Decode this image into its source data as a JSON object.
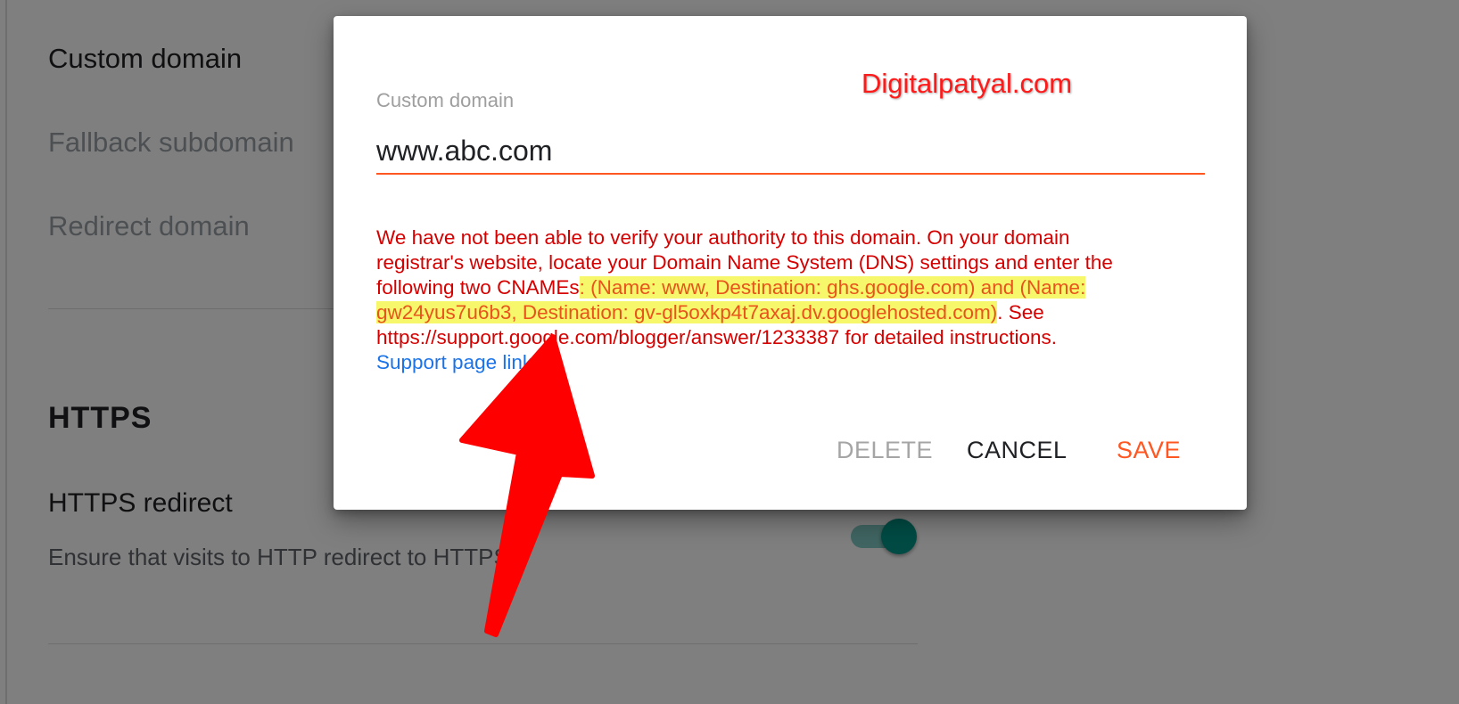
{
  "background": {
    "settings": {
      "custom_domain": "Custom domain",
      "fallback_subdomain": "Fallback subdomain",
      "redirect_domain": "Redirect domain"
    },
    "https": {
      "section_title": "HTTPS",
      "redirect_label": "HTTPS redirect",
      "redirect_description": "Ensure that visits to HTTP redirect to HTTPS",
      "toggle_on": true
    }
  },
  "dialog": {
    "field_label": "Custom domain",
    "input_value": "www.abc.com",
    "watermark": "Digitalpatyal.com",
    "error": {
      "part1": "We have not been able to verify your authority to this domain. On your domain registrar's website, locate your Domain Name System (DNS) settings and enter the following two CNAMEs",
      "highlight1": ": (Name: www, Destination: ghs.google.com) and (Name: gw24yus7u6b3, Destination: gv-gl5oxkp4t7axaj.dv.googlehosted.com)",
      "part2": ". See https://support.google.com/blogger/answer/1233387 for detailed instructions.",
      "support_link": "Support page link"
    },
    "buttons": {
      "delete": "DELETE",
      "cancel": "CANCEL",
      "save": "SAVE"
    }
  },
  "colors": {
    "accent": "#ff5722",
    "error": "#d50000",
    "link": "#1a73e8",
    "highlight": "#f6f76a",
    "toggle": "#009688",
    "arrow": "#ff0000"
  },
  "icons": {
    "annotation": "red-arrow-icon"
  }
}
